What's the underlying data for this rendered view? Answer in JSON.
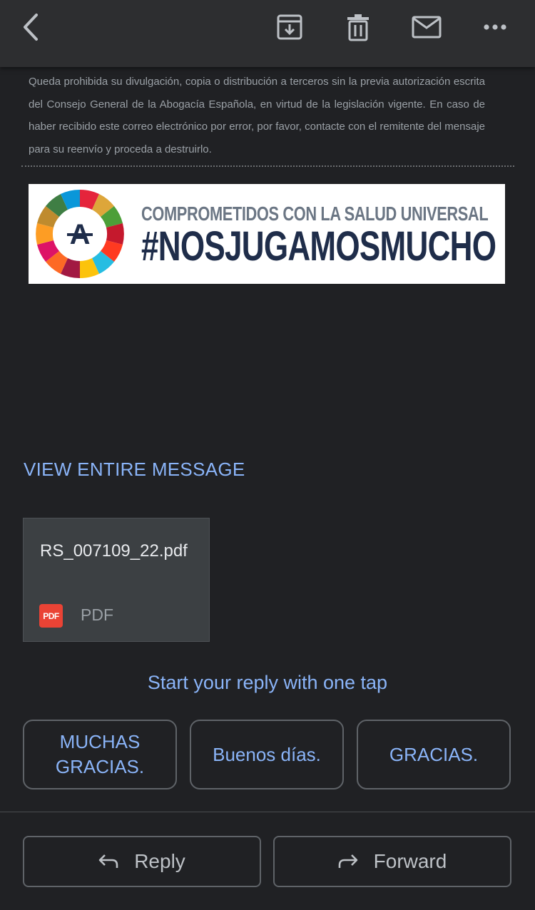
{
  "toolbar": {
    "back_icon": "arrow-back-icon",
    "archive_icon": "archive-icon",
    "delete_icon": "trash-icon",
    "mark_unread_icon": "mail-icon",
    "more_icon": "more-horizontal-icon"
  },
  "email": {
    "disclaimer": "Queda prohibida su divulgación, copia o distribución a terceros sin la previa autorización escrita del Consejo General de la Abogacía Española, en virtud de la legislación vigente. En caso de haber recibido este correo electrónico por error, por favor, contacte con el remitente del mensaje para su reenvío y proceda a destruirlo.",
    "banner": {
      "line1": "COMPROMETIDOS CON LA SALUD UNIVERSAL",
      "line2": "#NOSJUGAMOSMUCHO",
      "logo_letter": "A"
    },
    "view_entire_label": "VIEW ENTIRE MESSAGE"
  },
  "attachment": {
    "filename": "RS_007109_22.pdf",
    "badge": "PDF",
    "type": "PDF"
  },
  "smart_reply": {
    "hint": "Start your reply with one tap",
    "chips": [
      "MUCHAS GRACIAS.",
      "Buenos días.",
      "GRACIAS."
    ]
  },
  "actions": {
    "reply_label": "Reply",
    "forward_label": "Forward"
  },
  "colors": {
    "background": "#202124",
    "toolbar": "#2d2e30",
    "link": "#8ab4f8",
    "pdf_red": "#ea4335"
  }
}
